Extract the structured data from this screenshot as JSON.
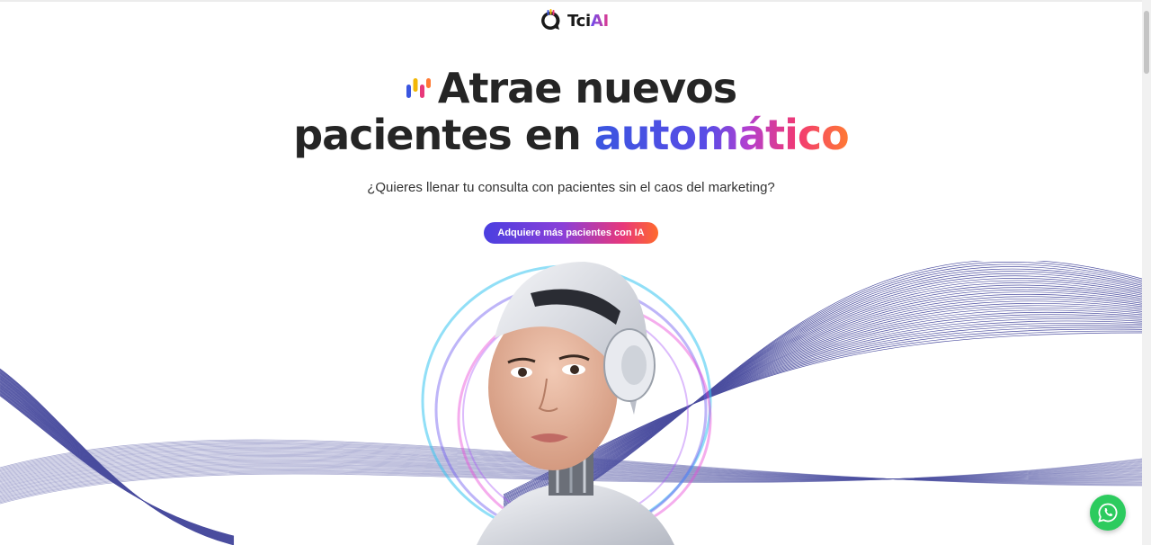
{
  "brand": {
    "name_prefix": "Tci",
    "name_suffix": "AI"
  },
  "hero": {
    "headline_line1": "Atrae nuevos",
    "headline_line2_plain": "pacientes en ",
    "headline_line2_highlight": "automático",
    "subtitle": "¿Quieres llenar tu consulta con pacientes sin el caos del marketing?",
    "cta_label": "Adquiere más pacientes con IA"
  },
  "icons": {
    "logo": "chat-bubble-logo-icon",
    "bars": "colored-bars-icon",
    "whatsapp": "whatsapp-icon"
  },
  "colors": {
    "gradient_start": "#3a56e0",
    "gradient_mid": "#b23fd0",
    "gradient_end": "#ff7a33",
    "whatsapp": "#2ccb5e",
    "wave": "#2c2f8f"
  }
}
